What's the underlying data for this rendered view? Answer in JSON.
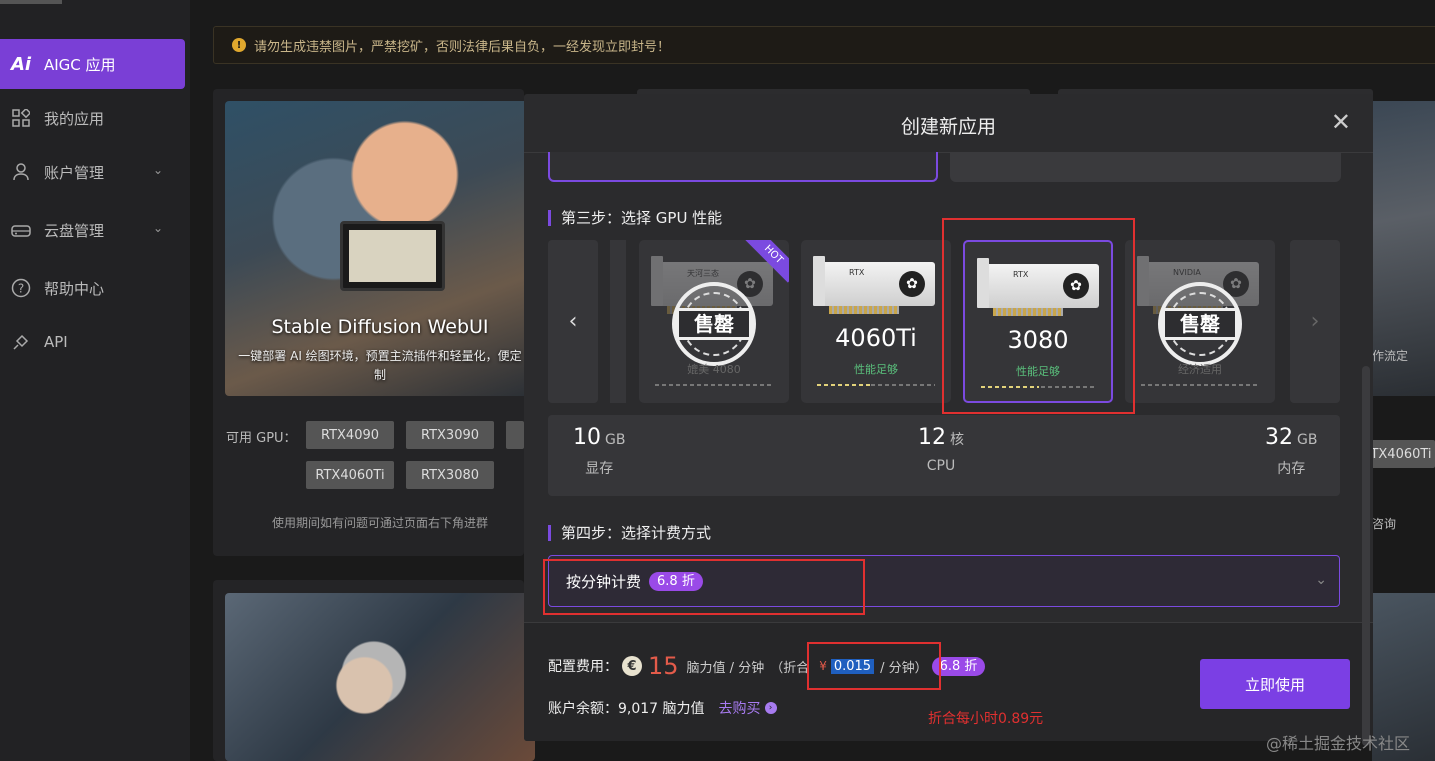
{
  "sidebar": {
    "items": [
      {
        "label": "AIGC 应用",
        "icon": "ai-icon",
        "active": true
      },
      {
        "label": "我的应用",
        "icon": "apps-grid-icon"
      },
      {
        "label": "账户管理",
        "icon": "user-icon",
        "has_children": true
      },
      {
        "label": "云盘管理",
        "icon": "cloud-disk-icon",
        "has_children": true
      },
      {
        "label": "帮助中心",
        "icon": "help-circle-icon"
      },
      {
        "label": "API",
        "icon": "api-plug-icon"
      }
    ]
  },
  "notice": {
    "text": "请勿生成违禁图片，严禁挖矿，否则法律后果自负，一经发现立即封号！"
  },
  "background": {
    "sd_card": {
      "title": "Stable Diffusion WebUI",
      "desc": "一键部署 AI 绘图环境，预置主流插件和轻量化，便定制",
      "gpu_label": "可用 GPU：",
      "gpu_tags": [
        "RTX4090",
        "RTX3090",
        "RTX4060Ti",
        "RTX3080"
      ],
      "help": "使用期间如有问题可通过页面右下角进群"
    },
    "right_edge": {
      "text1": "作流定",
      "tag": "TX4060Ti",
      "text2": "咨询"
    }
  },
  "modal": {
    "title": "创建新应用",
    "step3_title": "第三步：选择 GPU 性能",
    "gpus": [
      {
        "name": "4080",
        "perf": "媲美 4080",
        "brand": "天河三态",
        "stamp": "售罄",
        "hot": "HOT",
        "soldout": true
      },
      {
        "name": "4060Ti",
        "perf": "性能足够",
        "brand": "RTX",
        "soldout": false
      },
      {
        "name": "3080",
        "perf": "性能足够",
        "brand": "RTX",
        "soldout": false,
        "selected": true
      },
      {
        "name": "",
        "perf": "经济适用",
        "brand": "NVIDIA",
        "stamp": "售罄",
        "soldout": true
      }
    ],
    "specs": {
      "vram": {
        "value": "10",
        "unit": "GB",
        "label": "显存"
      },
      "cpu": {
        "value": "12",
        "unit": "核",
        "label": "CPU"
      },
      "ram": {
        "value": "32",
        "unit": "GB",
        "label": "内存"
      }
    },
    "step4_title": "第四步：选择计费方式",
    "billing": {
      "selected": "按分钟计费",
      "discount": "6.8 折"
    },
    "footer": {
      "cost_label": "配置费用：",
      "price": "15",
      "price_unit": "脑力值 / 分钟",
      "convert_prefix": "（折合",
      "yen": "¥",
      "yen_value": "0.015",
      "yen_unit": "/ 分钟）",
      "discount": "6.8 折",
      "balance_label": "账户余额：",
      "balance": "9,017 脑力值",
      "buy_link": "去购买",
      "use_button": "立即使用"
    }
  },
  "annotation": {
    "text": "折合每小时0.89元"
  },
  "watermark": "@稀土掘金技术社区",
  "colors": {
    "accent": "#7b4ae0",
    "badge": "#9a4ae8",
    "price": "#e35b4a",
    "annotation": "#e03030"
  }
}
